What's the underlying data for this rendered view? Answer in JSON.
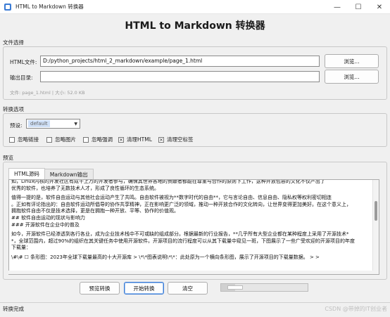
{
  "window": {
    "title": "HTML to Markdown 转换器",
    "controls": {
      "minimize": "—",
      "maximize": "☐",
      "close": "✕"
    }
  },
  "heading": "HTML to Markdown 转换器",
  "file_section": {
    "label": "文件选择",
    "html_file_label": "HTML文件:",
    "html_file_value": "D:/python_projects/html_2_markdown/example/page_1.html",
    "browse_label": "浏览...",
    "output_dir_label": "输出目录:",
    "output_dir_value": "",
    "browse2_label": "浏览...",
    "file_info": "文件: page_1.html | 大小: 52.0 KB"
  },
  "options_section": {
    "label": "转换选项",
    "preset_label": "预设:",
    "preset_value": "default",
    "checkboxes": [
      {
        "label": "忽略链接",
        "checked": false,
        "mark": ""
      },
      {
        "label": "忽略图片",
        "checked": false,
        "mark": ""
      },
      {
        "label": "忽略强调",
        "checked": false,
        "mark": ""
      },
      {
        "label": "清理HTML",
        "checked": true,
        "mark": "×"
      },
      {
        "label": "清理空标签",
        "checked": true,
        "mark": "×"
      }
    ]
  },
  "preview_section": {
    "label": "预览",
    "tabs": [
      {
        "label": "HTML源码",
        "active": true
      },
      {
        "label": "Markdown输出",
        "active": false
      }
    ],
    "lines": [
      "如，Linux内核的开发社区有成千上万的开发者参与，确保其世界各地的贡献者都能在尊重与合作的原则下工作，这种开放包容的文化不仅产出了",
      "优秀的软件，也培养了无数技术人才，形成了良性循环的生态系统。",
      "",
      "值得一提的是，软件自由运动与其他社会运动产生了共鸣。自由软件被视为**数字时代的自由**，它与言论自由、信息自由、隐私权等权利密切相连",
      "。正如有评论指出的：自由软件运动所倡导的协作共享精神，正在影响更广泛的领域，推动一种开放合作的文化转向，让世界变得更加美好。在这个意义上，",
      "拥抱软件自由不仅是技术选择，更是在拥抱一种开放、平等、协作的价值观。",
      "## 软件自由运动的现状与影响力",
      "### 开源软件在企业中的普及",
      "",
      "如今，开源软件已经渗透到各行各业，成为企业技术栈中不可或缺的组成部分。根据最新的行业报告，**几乎所有大型企业都在某种程度上采用了开源技术*",
      "*，全球范围内，超过90%的组织在其关键任务中使用开源软件。开源项目的流行程度可以从其下载量中窥见一斑，下图展示了一些广受欢迎的开源项目的年度",
      "下载量：",
      "",
      "\\#\\# ☐ 条形图：2023年全球下载量最高的十大开源库 > \\*\\*图表说明\\*\\*：此处原为一个横向条形图，展示了开源项目的下载量数据。 > >"
    ]
  },
  "actions": {
    "preview_label": "预览转换",
    "start_label": "开始转换",
    "clear_label": "清空",
    "progress": 0.16
  },
  "status": "转换完成",
  "watermark": "CSDN @带掉的IT创业者"
}
